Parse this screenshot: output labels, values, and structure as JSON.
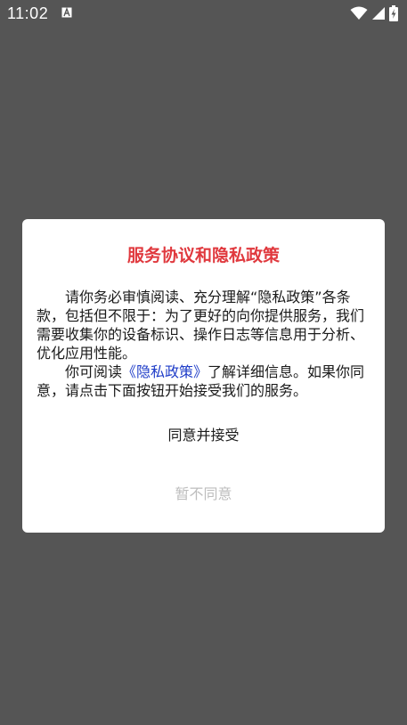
{
  "status_bar": {
    "time": "11:02",
    "icons": [
      "text-a-icon",
      "wifi-icon",
      "signal-icon",
      "battery-charging-icon"
    ]
  },
  "dialog": {
    "title": "服务协议和隐私政策",
    "paragraph1": "请你务必审慎阅读、充分理解“隐私政策”各条款，包括但不限于：为了更好的向你提供服务，我们需要收集你的设备标识、操作日志等信息用于分析、优化应用性能。",
    "paragraph2_before": "你可阅读",
    "paragraph2_link": "《隐私政策》",
    "paragraph2_after": "了解详细信息。如果你同意，请点击下面按钮开始接受我们的服务。",
    "agree_label": "同意并接受",
    "disagree_label": "暂不同意"
  },
  "colors": {
    "overlay": "#555555",
    "title": "#e0393e",
    "link": "#1e3cc8",
    "disabled_text": "#bdbdbd"
  }
}
